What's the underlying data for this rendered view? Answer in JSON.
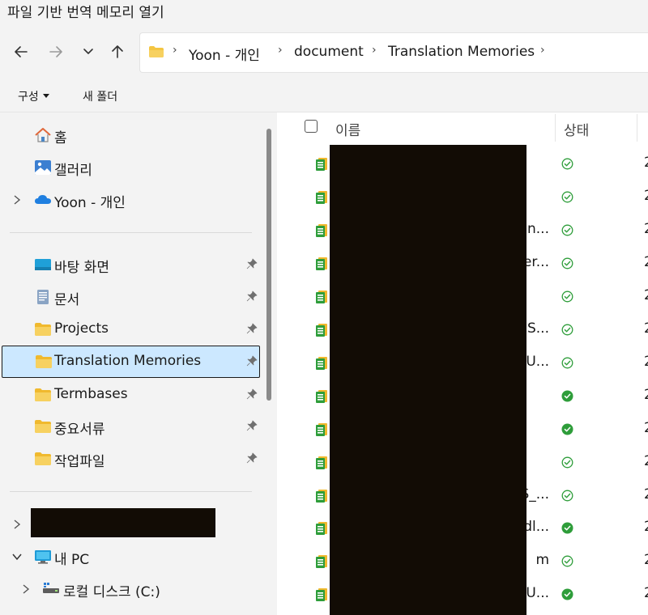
{
  "window": {
    "title": "파일 기반 번역 메모리 열기"
  },
  "nav": {
    "back_icon": "back-arrow-icon",
    "forward_icon": "forward-arrow-icon",
    "recent_icon": "chevron-down-icon",
    "up_icon": "up-arrow-icon"
  },
  "address": {
    "crumbs": [
      {
        "label": "Yoon - 개인"
      },
      {
        "label": "document"
      },
      {
        "label": "Translation Memories"
      }
    ]
  },
  "toolbar": {
    "organize_label": "구성",
    "new_folder_label": "새 폴더"
  },
  "sidebar": {
    "top_items": [
      {
        "label": "홈",
        "icon": "home-icon"
      },
      {
        "label": "갤러리",
        "icon": "gallery-icon"
      },
      {
        "label": "Yoon - 개인",
        "icon": "cloud-icon",
        "expandable": true
      }
    ],
    "pinned_items": [
      {
        "label": "바탕 화면",
        "icon": "desktop-icon",
        "pinned": true
      },
      {
        "label": "문서",
        "icon": "document-icon",
        "pinned": true
      },
      {
        "label": "Projects",
        "icon": "folder-icon",
        "pinned": true
      },
      {
        "label": "Translation Memories",
        "icon": "folder-icon",
        "pinned": true,
        "selected": true
      },
      {
        "label": "Termbases",
        "icon": "folder-icon",
        "pinned": true
      },
      {
        "label": "중요서류",
        "icon": "folder-icon",
        "pinned": true
      },
      {
        "label": "작업파일",
        "icon": "folder-icon",
        "pinned": true
      }
    ],
    "tree_items": [
      {
        "label": "",
        "redacted": true,
        "expandable": true
      },
      {
        "label": "내 PC",
        "icon": "pc-icon",
        "expanded": true
      },
      {
        "label": "로컬 디스크 (C:)",
        "icon": "drive-icon",
        "expandable": true
      }
    ]
  },
  "filelist": {
    "columns": {
      "name": "이름",
      "status": "상태"
    },
    "rows": [
      {
        "tail": "",
        "status": "available"
      },
      {
        "tail": "",
        "status": "available"
      },
      {
        "tail": "en...",
        "status": "available"
      },
      {
        "tail": "er...",
        "status": "available"
      },
      {
        "tail": "",
        "status": "available"
      },
      {
        "tail": "S...",
        "status": "available"
      },
      {
        "tail": "U...",
        "status": "available"
      },
      {
        "tail": "",
        "status": "always-available"
      },
      {
        "tail": "",
        "status": "always-available"
      },
      {
        "tail": "",
        "status": "available"
      },
      {
        "tail": "S_...",
        "status": "available"
      },
      {
        "tail": "dl...",
        "status": "always-available"
      },
      {
        "tail": "m",
        "status": "available"
      },
      {
        "tail": "U...",
        "status": "always-available"
      }
    ],
    "date_cut_text": "2"
  },
  "colors": {
    "accent_folder": "#f4c542",
    "status_green": "#2e9d3a",
    "selection": "#cce8ff",
    "redaction": "#120c05"
  }
}
